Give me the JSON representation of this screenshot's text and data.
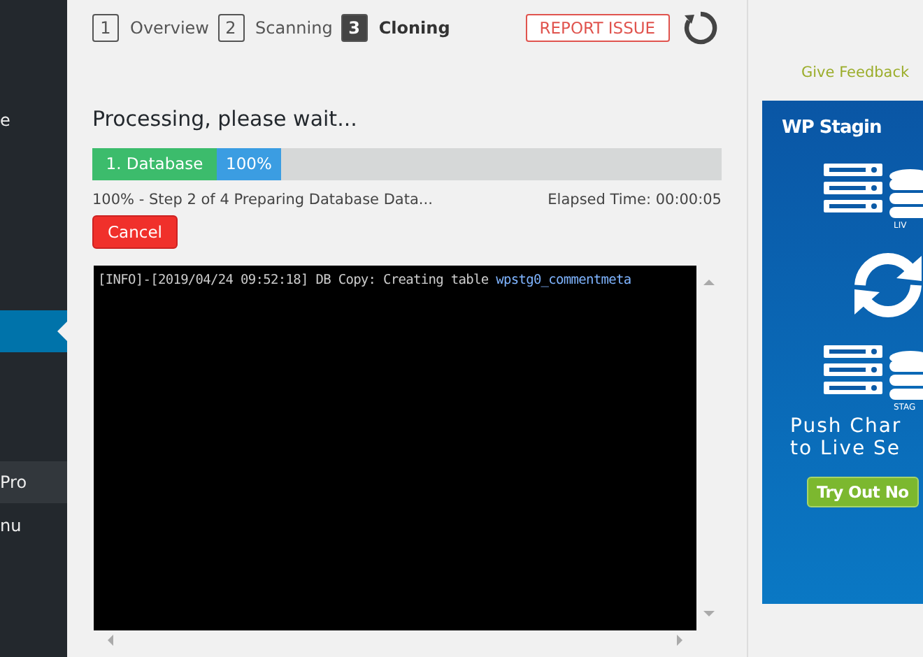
{
  "sidebar": {
    "items": [
      {
        "label": "e",
        "selected": false
      },
      {
        "selected": true
      },
      {
        "label": "Pro",
        "selected": false,
        "kind": "submenu"
      },
      {
        "label": "nu",
        "selected": false
      }
    ]
  },
  "steps": [
    {
      "number": "1",
      "label": "Overview",
      "selected": false
    },
    {
      "number": "2",
      "label": "Scanning",
      "selected": false
    },
    {
      "number": "3",
      "label": "Cloning",
      "selected": true
    }
  ],
  "report_button": "REPORT ISSUE",
  "heading": "Processing, please wait...",
  "progress": {
    "label": "1. Database",
    "reading": "100%",
    "level": 0.3
  },
  "status": "100% - Step 2 of 4 Preparing Database Data...",
  "elapsed": "Elapsed Time: 00:00:05",
  "cancel_button": "Cancel",
  "log": [
    {
      "prefix": "[INFO]-[2019/04/24 09:52:18] DB Copy: Creating table ",
      "table": "wpstg0_commentmeta"
    }
  ],
  "feedback_link": "Give Feedback",
  "banner": {
    "logo": "WP Stagin",
    "live_label": "LIV",
    "staging_label": "STAG",
    "headline": [
      "Push Char",
      "to Live Se"
    ],
    "button": "Try Out No"
  }
}
